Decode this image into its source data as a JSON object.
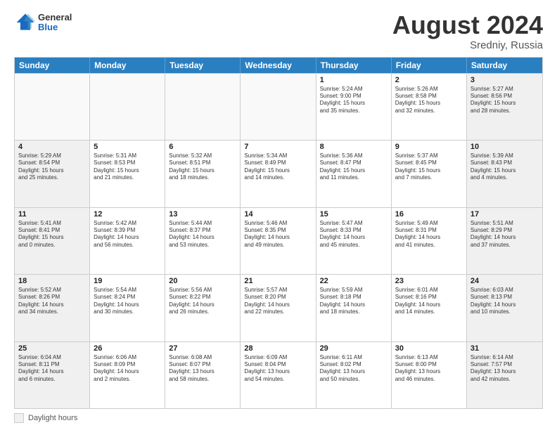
{
  "header": {
    "logo_general": "General",
    "logo_blue": "Blue",
    "main_title": "August 2024",
    "subtitle": "Sredniy, Russia"
  },
  "calendar": {
    "days_of_week": [
      "Sunday",
      "Monday",
      "Tuesday",
      "Wednesday",
      "Thursday",
      "Friday",
      "Saturday"
    ],
    "rows": [
      [
        {
          "day": "",
          "text": "",
          "empty": true
        },
        {
          "day": "",
          "text": "",
          "empty": true
        },
        {
          "day": "",
          "text": "",
          "empty": true
        },
        {
          "day": "",
          "text": "",
          "empty": true
        },
        {
          "day": "1",
          "text": "Sunrise: 5:24 AM\nSunset: 9:00 PM\nDaylight: 15 hours\nand 35 minutes.",
          "empty": false
        },
        {
          "day": "2",
          "text": "Sunrise: 5:26 AM\nSunset: 8:58 PM\nDaylight: 15 hours\nand 32 minutes.",
          "empty": false
        },
        {
          "day": "3",
          "text": "Sunrise: 5:27 AM\nSunset: 8:56 PM\nDaylight: 15 hours\nand 28 minutes.",
          "empty": false,
          "shaded": true
        }
      ],
      [
        {
          "day": "4",
          "text": "Sunrise: 5:29 AM\nSunset: 8:54 PM\nDaylight: 15 hours\nand 25 minutes.",
          "shaded": true
        },
        {
          "day": "5",
          "text": "Sunrise: 5:31 AM\nSunset: 8:53 PM\nDaylight: 15 hours\nand 21 minutes."
        },
        {
          "day": "6",
          "text": "Sunrise: 5:32 AM\nSunset: 8:51 PM\nDaylight: 15 hours\nand 18 minutes."
        },
        {
          "day": "7",
          "text": "Sunrise: 5:34 AM\nSunset: 8:49 PM\nDaylight: 15 hours\nand 14 minutes."
        },
        {
          "day": "8",
          "text": "Sunrise: 5:36 AM\nSunset: 8:47 PM\nDaylight: 15 hours\nand 11 minutes."
        },
        {
          "day": "9",
          "text": "Sunrise: 5:37 AM\nSunset: 8:45 PM\nDaylight: 15 hours\nand 7 minutes."
        },
        {
          "day": "10",
          "text": "Sunrise: 5:39 AM\nSunset: 8:43 PM\nDaylight: 15 hours\nand 4 minutes.",
          "shaded": true
        }
      ],
      [
        {
          "day": "11",
          "text": "Sunrise: 5:41 AM\nSunset: 8:41 PM\nDaylight: 15 hours\nand 0 minutes.",
          "shaded": true
        },
        {
          "day": "12",
          "text": "Sunrise: 5:42 AM\nSunset: 8:39 PM\nDaylight: 14 hours\nand 56 minutes."
        },
        {
          "day": "13",
          "text": "Sunrise: 5:44 AM\nSunset: 8:37 PM\nDaylight: 14 hours\nand 53 minutes."
        },
        {
          "day": "14",
          "text": "Sunrise: 5:46 AM\nSunset: 8:35 PM\nDaylight: 14 hours\nand 49 minutes."
        },
        {
          "day": "15",
          "text": "Sunrise: 5:47 AM\nSunset: 8:33 PM\nDaylight: 14 hours\nand 45 minutes."
        },
        {
          "day": "16",
          "text": "Sunrise: 5:49 AM\nSunset: 8:31 PM\nDaylight: 14 hours\nand 41 minutes."
        },
        {
          "day": "17",
          "text": "Sunrise: 5:51 AM\nSunset: 8:29 PM\nDaylight: 14 hours\nand 37 minutes.",
          "shaded": true
        }
      ],
      [
        {
          "day": "18",
          "text": "Sunrise: 5:52 AM\nSunset: 8:26 PM\nDaylight: 14 hours\nand 34 minutes.",
          "shaded": true
        },
        {
          "day": "19",
          "text": "Sunrise: 5:54 AM\nSunset: 8:24 PM\nDaylight: 14 hours\nand 30 minutes."
        },
        {
          "day": "20",
          "text": "Sunrise: 5:56 AM\nSunset: 8:22 PM\nDaylight: 14 hours\nand 26 minutes."
        },
        {
          "day": "21",
          "text": "Sunrise: 5:57 AM\nSunset: 8:20 PM\nDaylight: 14 hours\nand 22 minutes."
        },
        {
          "day": "22",
          "text": "Sunrise: 5:59 AM\nSunset: 8:18 PM\nDaylight: 14 hours\nand 18 minutes."
        },
        {
          "day": "23",
          "text": "Sunrise: 6:01 AM\nSunset: 8:16 PM\nDaylight: 14 hours\nand 14 minutes."
        },
        {
          "day": "24",
          "text": "Sunrise: 6:03 AM\nSunset: 8:13 PM\nDaylight: 14 hours\nand 10 minutes.",
          "shaded": true
        }
      ],
      [
        {
          "day": "25",
          "text": "Sunrise: 6:04 AM\nSunset: 8:11 PM\nDaylight: 14 hours\nand 6 minutes.",
          "shaded": true
        },
        {
          "day": "26",
          "text": "Sunrise: 6:06 AM\nSunset: 8:09 PM\nDaylight: 14 hours\nand 2 minutes."
        },
        {
          "day": "27",
          "text": "Sunrise: 6:08 AM\nSunset: 8:07 PM\nDaylight: 13 hours\nand 58 minutes."
        },
        {
          "day": "28",
          "text": "Sunrise: 6:09 AM\nSunset: 8:04 PM\nDaylight: 13 hours\nand 54 minutes."
        },
        {
          "day": "29",
          "text": "Sunrise: 6:11 AM\nSunset: 8:02 PM\nDaylight: 13 hours\nand 50 minutes."
        },
        {
          "day": "30",
          "text": "Sunrise: 6:13 AM\nSunset: 8:00 PM\nDaylight: 13 hours\nand 46 minutes."
        },
        {
          "day": "31",
          "text": "Sunrise: 6:14 AM\nSunset: 7:57 PM\nDaylight: 13 hours\nand 42 minutes.",
          "shaded": true
        }
      ]
    ]
  },
  "footer": {
    "legend_label": "Daylight hours"
  }
}
